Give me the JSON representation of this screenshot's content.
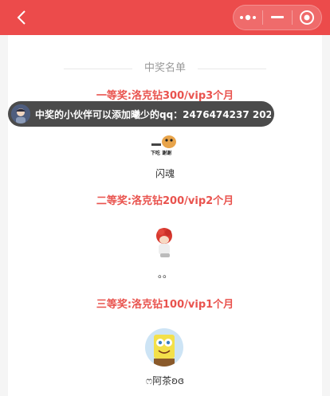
{
  "nav": {
    "title": "",
    "menu_icon": "more-dots-icon",
    "minimize_icon": "minimize-icon",
    "close_icon": "target-close-icon",
    "back_icon": "chevron-left-icon",
    "bar_color": "#ec4b4b"
  },
  "list": {
    "title": "中奖名单",
    "prizes": [
      {
        "label": "一等奖:洛克钻300/vip3个月",
        "winner": "闪魂"
      },
      {
        "label": "二等奖:洛克钻200/vip2个月",
        "winner": "。。"
      },
      {
        "label": "三等奖:洛克钻100/vip1个月",
        "winner": "ෆ阿茶ʚɞ"
      }
    ]
  },
  "toast": {
    "text": "中奖的小伙伴可以添加曦少的qq：2476474237 202..."
  }
}
